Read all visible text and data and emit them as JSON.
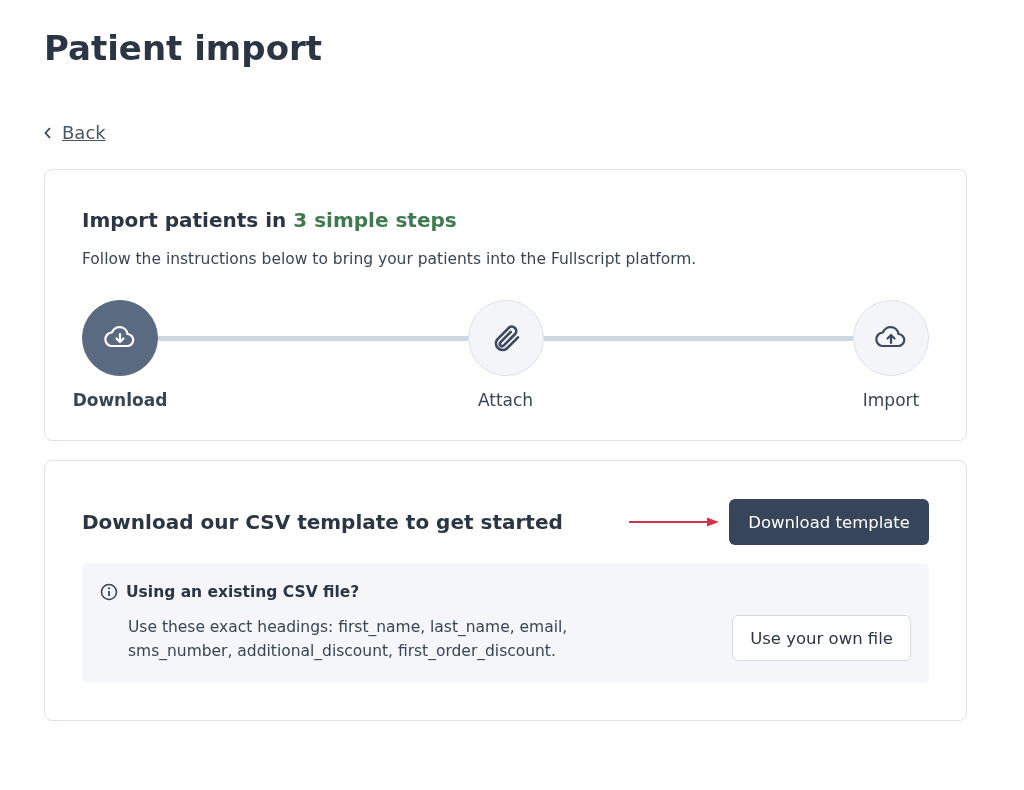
{
  "page": {
    "title": "Patient import",
    "back_link": "Back"
  },
  "steps_card": {
    "title": "Import patients in ",
    "title_highlight": "3 simple steps",
    "description": "Follow the instructions below to bring your patients into the Fullscript platform.",
    "steps": [
      {
        "kind": "download",
        "label": "Download",
        "selected": true
      },
      {
        "kind": "attach",
        "label": "Attach",
        "selected": false
      },
      {
        "kind": "import",
        "label": "Import",
        "selected": false
      }
    ]
  },
  "download_card": {
    "title": "Download our CSV template to get started",
    "button": "Download template",
    "info": {
      "title": "Using an existing CSV file?",
      "text": "Use these exact headings: first_name, last_name, email, sms_number, additional_discount, first_order_discount.",
      "button": "Use your own file"
    }
  }
}
